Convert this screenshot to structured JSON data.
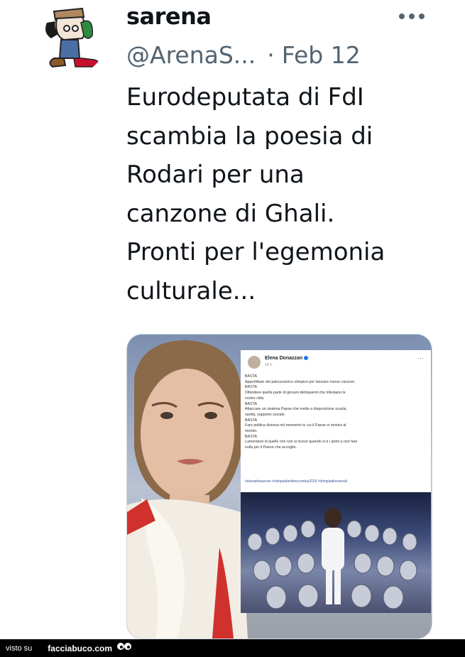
{
  "tweet": {
    "display_name": "sarena",
    "handle": "@ArenaS...",
    "separator": "·",
    "date": "Feb 12",
    "text": "Eurodeputata di FdI\nscambia la poesia di\nRodari per una\ncanzone di Ghali.\nPronti per l'egemonia\nculturale..."
  },
  "embedded_post": {
    "author": "Elena Donazzan",
    "time": "19 h · ",
    "more": "···",
    "body": "BASTA\nApprofittare del palcoscenico olimpico per lanciare nuove canzoni.\nBASTA\nDifendere quella parte di giovani delinquenti che infestano le\nnostre città.\nBASTA\nAttaccare un sistema Paese che mette a disposizione scuola,\nsanità, supporto sociale.\nBASTA\nFare politica divisiva nel momento in cui il Paese si mostra al\nmondo.\nBASTA\nLamentarsi di quello che non si riceve quando si è i primi a non fare\nnulla per il Paese che accoglie.",
    "hashtags": "#elenadonazzan #olimpiadimilanocortina2026 #olimpiadiinvernali"
  },
  "footer": {
    "via": "visto su",
    "site": "facciabuco.com"
  },
  "colors": {
    "text": "#0f1419",
    "secondary": "#536471",
    "footer_bg": "#000000"
  },
  "icons": [
    "more-options-icon",
    "verified-badge-icon",
    "facciabuco-logo-icon"
  ]
}
